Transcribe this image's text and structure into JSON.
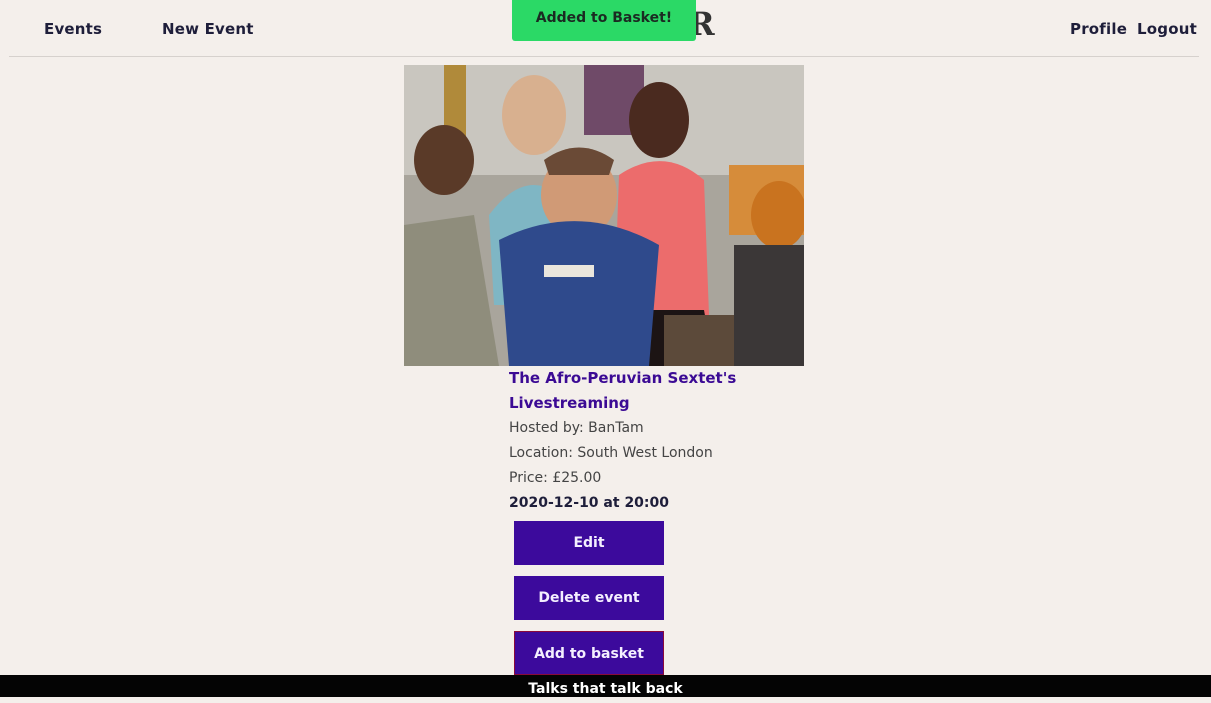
{
  "nav": {
    "events": "Events",
    "new_event": "New Event",
    "profile": "Profile",
    "logout": "Logout",
    "logo_fragment": "R"
  },
  "toast": {
    "message": "Added to Basket!"
  },
  "event": {
    "title": "The Afro-Peruvian Sextet's Livestreaming",
    "hosted_by": "Hosted by: BanTam",
    "location": "Location: South West London",
    "price": "Price: £25.00",
    "datetime": "2020-12-10 at 20:00"
  },
  "actions": {
    "edit": "Edit",
    "delete": "Delete event",
    "add_to_basket": "Add to basket"
  },
  "footer": {
    "tagline": "Talks that talk back"
  },
  "colors": {
    "background": "#f4efeb",
    "accent": "#3c0a9c",
    "toast": "#2bd966",
    "footer": "#040404"
  }
}
